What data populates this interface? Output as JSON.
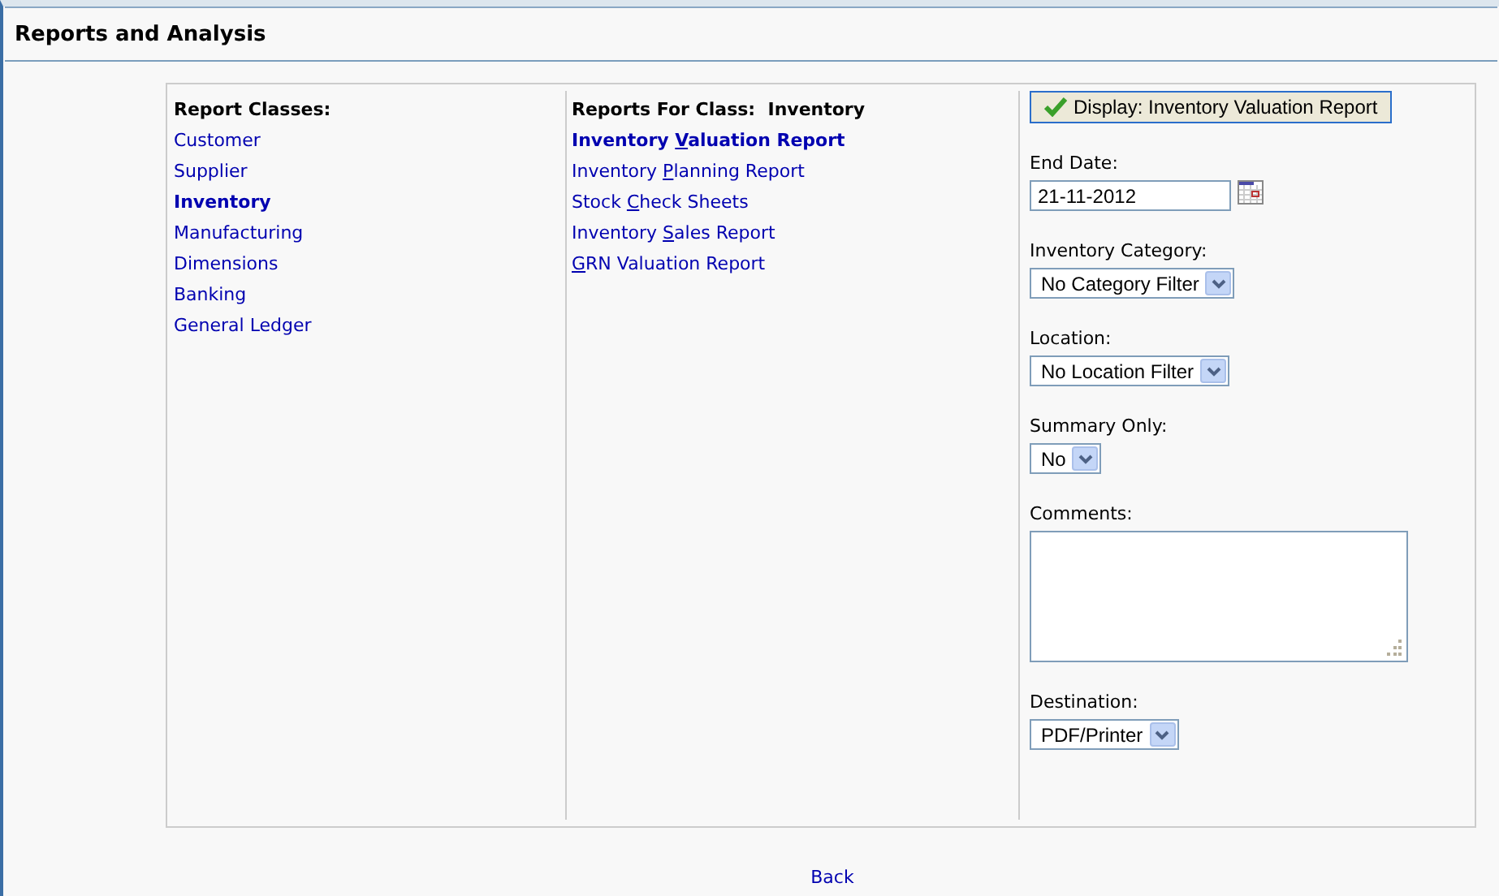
{
  "page_title": "Reports and Analysis",
  "report_classes": {
    "heading": "Report Classes:",
    "items": [
      {
        "label": "Customer",
        "selected": false
      },
      {
        "label": "Supplier",
        "selected": false
      },
      {
        "label": "Inventory",
        "selected": true
      },
      {
        "label": "Manufacturing",
        "selected": false
      },
      {
        "label": "Dimensions",
        "selected": false
      },
      {
        "label": "Banking",
        "selected": false
      },
      {
        "label": "General Ledger",
        "selected": false
      }
    ]
  },
  "reports": {
    "heading": "Reports For Class:  Inventory",
    "items": [
      {
        "before": "Inventory ",
        "hotkey": "V",
        "after": "aluation Report",
        "selected": true
      },
      {
        "before": "Inventory ",
        "hotkey": "P",
        "after": "lanning Report",
        "selected": false
      },
      {
        "before": "Stock ",
        "hotkey": "C",
        "after": "heck Sheets",
        "selected": false
      },
      {
        "before": "Inventory ",
        "hotkey": "S",
        "after": "ales Report",
        "selected": false
      },
      {
        "hotkey": "G",
        "after": "RN Valuation Report",
        "selected": false
      }
    ]
  },
  "display_button": "Display: Inventory Valuation Report",
  "parameters": [
    {
      "kind": "date",
      "label": "End Date:",
      "value": "21-11-2012"
    },
    {
      "kind": "select",
      "label": "Inventory Category:",
      "value": "No Category Filter"
    },
    {
      "kind": "select",
      "label": "Location:",
      "value": "No Location Filter"
    },
    {
      "kind": "select",
      "label": "Summary Only:",
      "value": "No"
    },
    {
      "kind": "textarea",
      "label": "Comments:"
    },
    {
      "kind": "select",
      "label": "Destination:",
      "value": "PDF/Printer"
    }
  ],
  "back_link": "Back"
}
